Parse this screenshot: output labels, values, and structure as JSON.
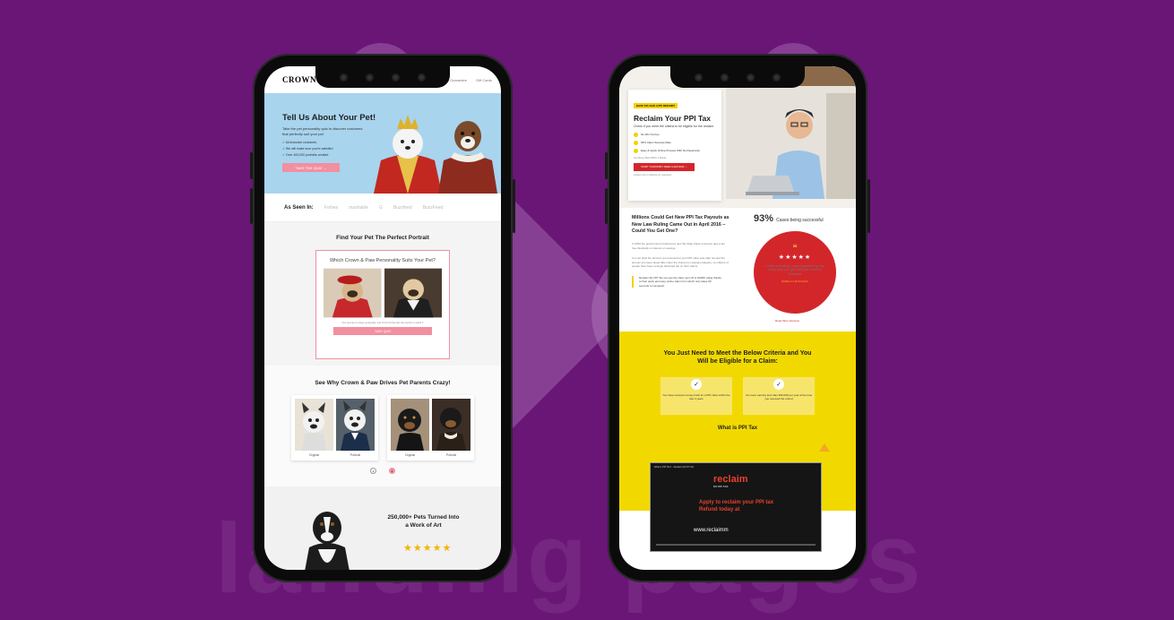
{
  "left_phone": {
    "header": {
      "logo": "CROWN & PAW",
      "link1": "Satisfaction Guarantee",
      "link2": "Gift Cards"
    },
    "hero": {
      "title": "Tell Us About Your Pet!",
      "subtitle": "Take the pet personality quiz to discover costumes that perfectly suit your pet",
      "bullets": [
        "All-inclusive costumes",
        "We will make sure you're satisfied",
        "Over 400,000 portraits created"
      ],
      "button": "TAKE THE QUIZ →"
    },
    "as_seen_in": {
      "label": "As Seen In:",
      "logos": [
        "Forbes",
        "mashable",
        "G",
        "Buzzfeed",
        "BuzzFeed"
      ]
    },
    "find": {
      "title": "Find Your Pet The Perfect Portrait",
      "question": "Which Crown & Paw Personality Suits Your Pet?",
      "small_text": "Your pet has a unique personality, and Crown & Paw has the portrait to match it.",
      "button": "TAKE QUIZ"
    },
    "see_why": {
      "title": "See Why Crown & Paw Drives Pet Parents Crazy!",
      "captions": [
        "Orginal",
        "Portrait",
        "Orginal",
        "Portrait"
      ],
      "dots": [
        "1",
        "2"
      ]
    },
    "pets": {
      "title": "250,000+ Pets Turned Into a Work of Art",
      "stars": "★★★★★"
    }
  },
  "right_phone": {
    "hero": {
      "tag": "HAVE YOU HAD A PPI REFUND?",
      "title": "Reclaim Your PPI Tax",
      "subtitle": "Check if you meet the criteria to be eligible for the reclaim.",
      "bullets": [
        "No Win No Fee",
        "93% Claim Success Rate",
        "Easy & Quick Online Process With No Paperwork"
      ],
      "small": "Get Money Back Within 4 Weeks",
      "button": "START YOUR RISKY FREE CLAIM NOW →",
      "footer": "Looked over to tracking our requested"
    },
    "mid": {
      "headline": "Millions Could Get New PPI Tax Payouts as New Law Ruling Came Out in April 2016 – Could You Get One?",
      "para1": "In 2016 the government introduced a new Tax Rule where everyone gets a tax free threshold on interest on savings.",
      "para2": "In a nut shell the amount you received for your PPI claim was after tax and the amount you were taxed falls under the interest on savings category, so millions of people have been wrongly deducted tax on their claims.",
      "callout": "Reclaim My PPI Tax can get the claim sent off to HMRC today thanks to their quick and easy online claim form which only takes 90 seconds to complete!",
      "percent": "93%",
      "percent_label": "Cases being successful",
      "review_stars": "★★★★★",
      "review_text": "It really is amazing, I never expected to get my money back but I got £1300 just in time for Christmas",
      "review_name": "REBECCA BURGESS",
      "read_more": "Read More Reviews"
    },
    "criteria": {
      "title": "You Just Need to Meet the Below Criteria and You Will be Eligible for a Claim:",
      "items": [
        "You have received money back for a PPI claim within the last 4 years",
        "You were earning less than £50,000 per year at the time you received the refund"
      ],
      "what_is": "What is PPI Tax"
    },
    "video": {
      "title": "What is PPI Tax? – Reclaim My PPI Tax",
      "logo": "reclaim",
      "logo_sub": "MY PPI TAX",
      "text": "Apply to reclaim your PPI tax Refund today at",
      "url": "www.reclaimm"
    }
  },
  "background_word": "landing pages"
}
